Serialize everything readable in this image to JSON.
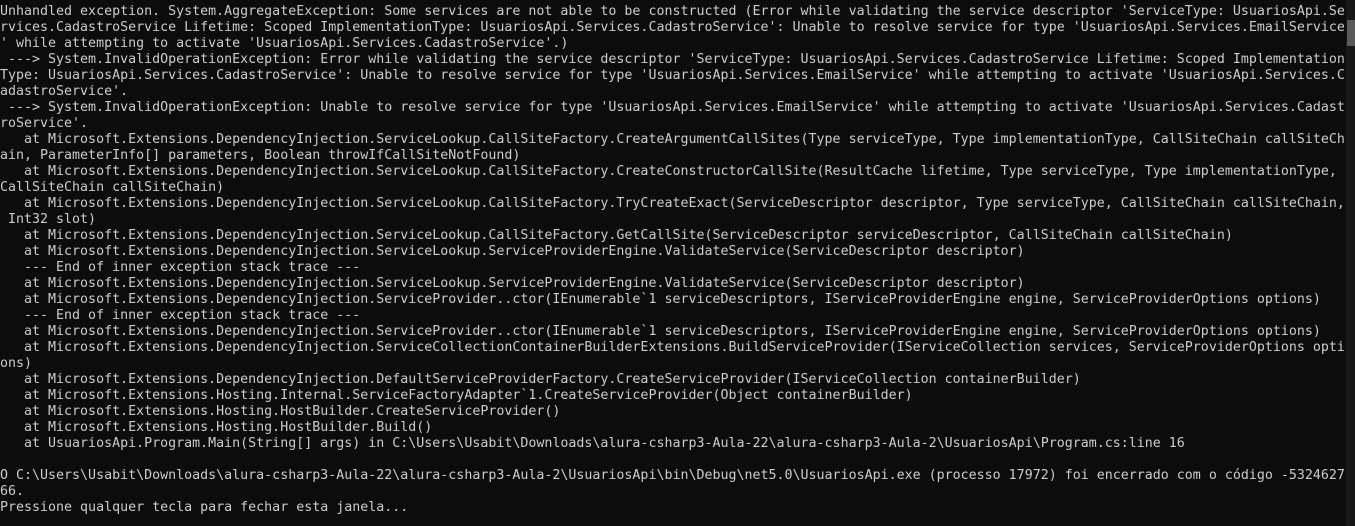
{
  "console": {
    "lines": [
      "Unhandled exception. System.AggregateException: Some services are not able to be constructed (Error while validating the service descriptor 'ServiceType: UsuariosApi.Se",
      "rvices.CadastroService Lifetime: Scoped ImplementationType: UsuariosApi.Services.CadastroService': Unable to resolve service for type 'UsuariosApi.Services.EmailService",
      "' while attempting to activate 'UsuariosApi.Services.CadastroService'.)",
      " ---> System.InvalidOperationException: Error while validating the service descriptor 'ServiceType: UsuariosApi.Services.CadastroService Lifetime: Scoped Implementation",
      "Type: UsuariosApi.Services.CadastroService': Unable to resolve service for type 'UsuariosApi.Services.EmailService' while attempting to activate 'UsuariosApi.Services.C",
      "adastroService'.",
      " ---> System.InvalidOperationException: Unable to resolve service for type 'UsuariosApi.Services.EmailService' while attempting to activate 'UsuariosApi.Services.Cadast",
      "roService'.",
      "   at Microsoft.Extensions.DependencyInjection.ServiceLookup.CallSiteFactory.CreateArgumentCallSites(Type serviceType, Type implementationType, CallSiteChain callSiteCh",
      "ain, ParameterInfo[] parameters, Boolean throwIfCallSiteNotFound)",
      "   at Microsoft.Extensions.DependencyInjection.ServiceLookup.CallSiteFactory.CreateConstructorCallSite(ResultCache lifetime, Type serviceType, Type implementationType,",
      "CallSiteChain callSiteChain)",
      "   at Microsoft.Extensions.DependencyInjection.ServiceLookup.CallSiteFactory.TryCreateExact(ServiceDescriptor descriptor, Type serviceType, CallSiteChain callSiteChain,",
      " Int32 slot)",
      "   at Microsoft.Extensions.DependencyInjection.ServiceLookup.CallSiteFactory.GetCallSite(ServiceDescriptor serviceDescriptor, CallSiteChain callSiteChain)",
      "   at Microsoft.Extensions.DependencyInjection.ServiceLookup.ServiceProviderEngine.ValidateService(ServiceDescriptor descriptor)",
      "   --- End of inner exception stack trace ---",
      "   at Microsoft.Extensions.DependencyInjection.ServiceLookup.ServiceProviderEngine.ValidateService(ServiceDescriptor descriptor)",
      "   at Microsoft.Extensions.DependencyInjection.ServiceProvider..ctor(IEnumerable`1 serviceDescriptors, IServiceProviderEngine engine, ServiceProviderOptions options)",
      "   --- End of inner exception stack trace ---",
      "   at Microsoft.Extensions.DependencyInjection.ServiceProvider..ctor(IEnumerable`1 serviceDescriptors, IServiceProviderEngine engine, ServiceProviderOptions options)",
      "   at Microsoft.Extensions.DependencyInjection.ServiceCollectionContainerBuilderExtensions.BuildServiceProvider(IServiceCollection services, ServiceProviderOptions opti",
      "ons)",
      "   at Microsoft.Extensions.DependencyInjection.DefaultServiceProviderFactory.CreateServiceProvider(IServiceCollection containerBuilder)",
      "   at Microsoft.Extensions.Hosting.Internal.ServiceFactoryAdapter`1.CreateServiceProvider(Object containerBuilder)",
      "   at Microsoft.Extensions.Hosting.HostBuilder.CreateServiceProvider()",
      "   at Microsoft.Extensions.Hosting.HostBuilder.Build()",
      "   at UsuariosApi.Program.Main(String[] args) in C:\\Users\\Usabit\\Downloads\\alura-csharp3-Aula-22\\alura-csharp3-Aula-2\\UsuariosApi\\Program.cs:line 16",
      "",
      "O C:\\Users\\Usabit\\Downloads\\alura-csharp3-Aula-22\\alura-csharp3-Aula-2\\UsuariosApi\\bin\\Debug\\net5.0\\UsuariosApi.exe (processo 17972) foi encerrado com o código -5324627",
      "66.",
      "Pressione qualquer tecla para fechar esta janela..."
    ]
  },
  "colors": {
    "background": "#0c0c0c",
    "text": "#cccccc"
  }
}
